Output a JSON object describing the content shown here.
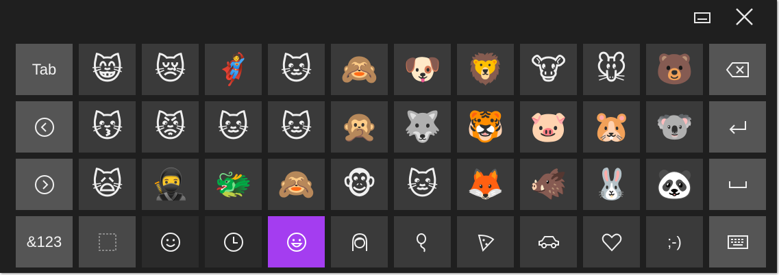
{
  "window": {
    "dock_icon": "dock-keyboard-icon",
    "close_icon": "close-icon"
  },
  "rows": [
    {
      "side_key": {
        "label": "Tab",
        "icon": null
      },
      "emojis": [
        "😸",
        "😿",
        "🦸",
        "🐱",
        "🙈",
        "🐶",
        "🦁",
        "🐮",
        "🐭",
        "🐻"
      ],
      "end_key": {
        "icon": "backspace-icon"
      }
    },
    {
      "side_key": {
        "label": null,
        "icon": "chevron-left-circle-icon"
      },
      "emojis": [
        "😽",
        "😾",
        "🐱",
        "🐱",
        "🙊",
        "🐺",
        "🐯",
        "🐷",
        "🐹",
        "🐨"
      ],
      "end_key": {
        "icon": "enter-icon"
      }
    },
    {
      "side_key": {
        "label": null,
        "icon": "chevron-right-circle-icon"
      },
      "emojis": [
        "🙀",
        "🥷",
        "🐲",
        "🙈",
        "🐵",
        "🐱",
        "🦊",
        "🐗",
        "🐰",
        "🐼"
      ],
      "end_key": {
        "icon": "space-icon"
      }
    }
  ],
  "bottom": {
    "symbols_label": "&123",
    "categories": [
      "stamp-icon",
      "smiley-icon",
      "clock-icon",
      "smile-face-icon",
      "person-icon",
      "balloon-icon",
      "pizza-icon",
      "car-icon",
      "heart-icon"
    ],
    "emoticon_label": ";-)",
    "active_category_index": 3,
    "keyboard_icon": "keyboard-icon"
  },
  "colors": {
    "accent": "#a43df0",
    "background": "#1f1f1f",
    "key": "#3a3a3a",
    "function_key": "#555555"
  }
}
